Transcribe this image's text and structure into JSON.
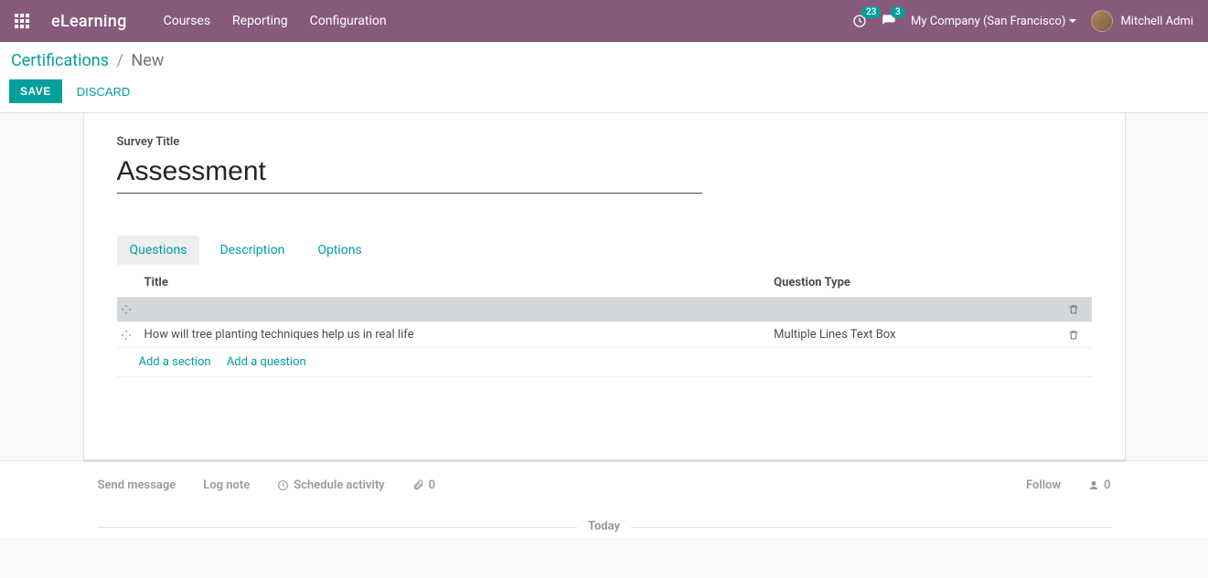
{
  "nav": {
    "brand": "eLearning",
    "links": [
      "Courses",
      "Reporting",
      "Configuration"
    ],
    "activity_count": "23",
    "message_count": "3",
    "company": "My Company (San Francisco)",
    "user": "Mitchell Admi"
  },
  "breadcrumb": {
    "root": "Certifications",
    "current": "New"
  },
  "actions": {
    "save": "SAVE",
    "discard": "DISCARD"
  },
  "form": {
    "title_label": "Survey Title",
    "title_value": "Assessment"
  },
  "tabs": {
    "questions": "Questions",
    "description": "Description",
    "options": "Options"
  },
  "table": {
    "col_title": "Title",
    "col_type": "Question Type",
    "rows": [
      {
        "kind": "section",
        "title": "",
        "type": ""
      },
      {
        "kind": "question",
        "title": "How will tree planting techniques help us in real life",
        "type": "Multiple Lines Text Box"
      }
    ],
    "add_section": "Add a section",
    "add_question": "Add a question"
  },
  "chatter": {
    "send": "Send message",
    "log": "Log note",
    "schedule": "Schedule activity",
    "attach_count": "0",
    "follow": "Follow",
    "followers_count": "0",
    "today": "Today"
  }
}
